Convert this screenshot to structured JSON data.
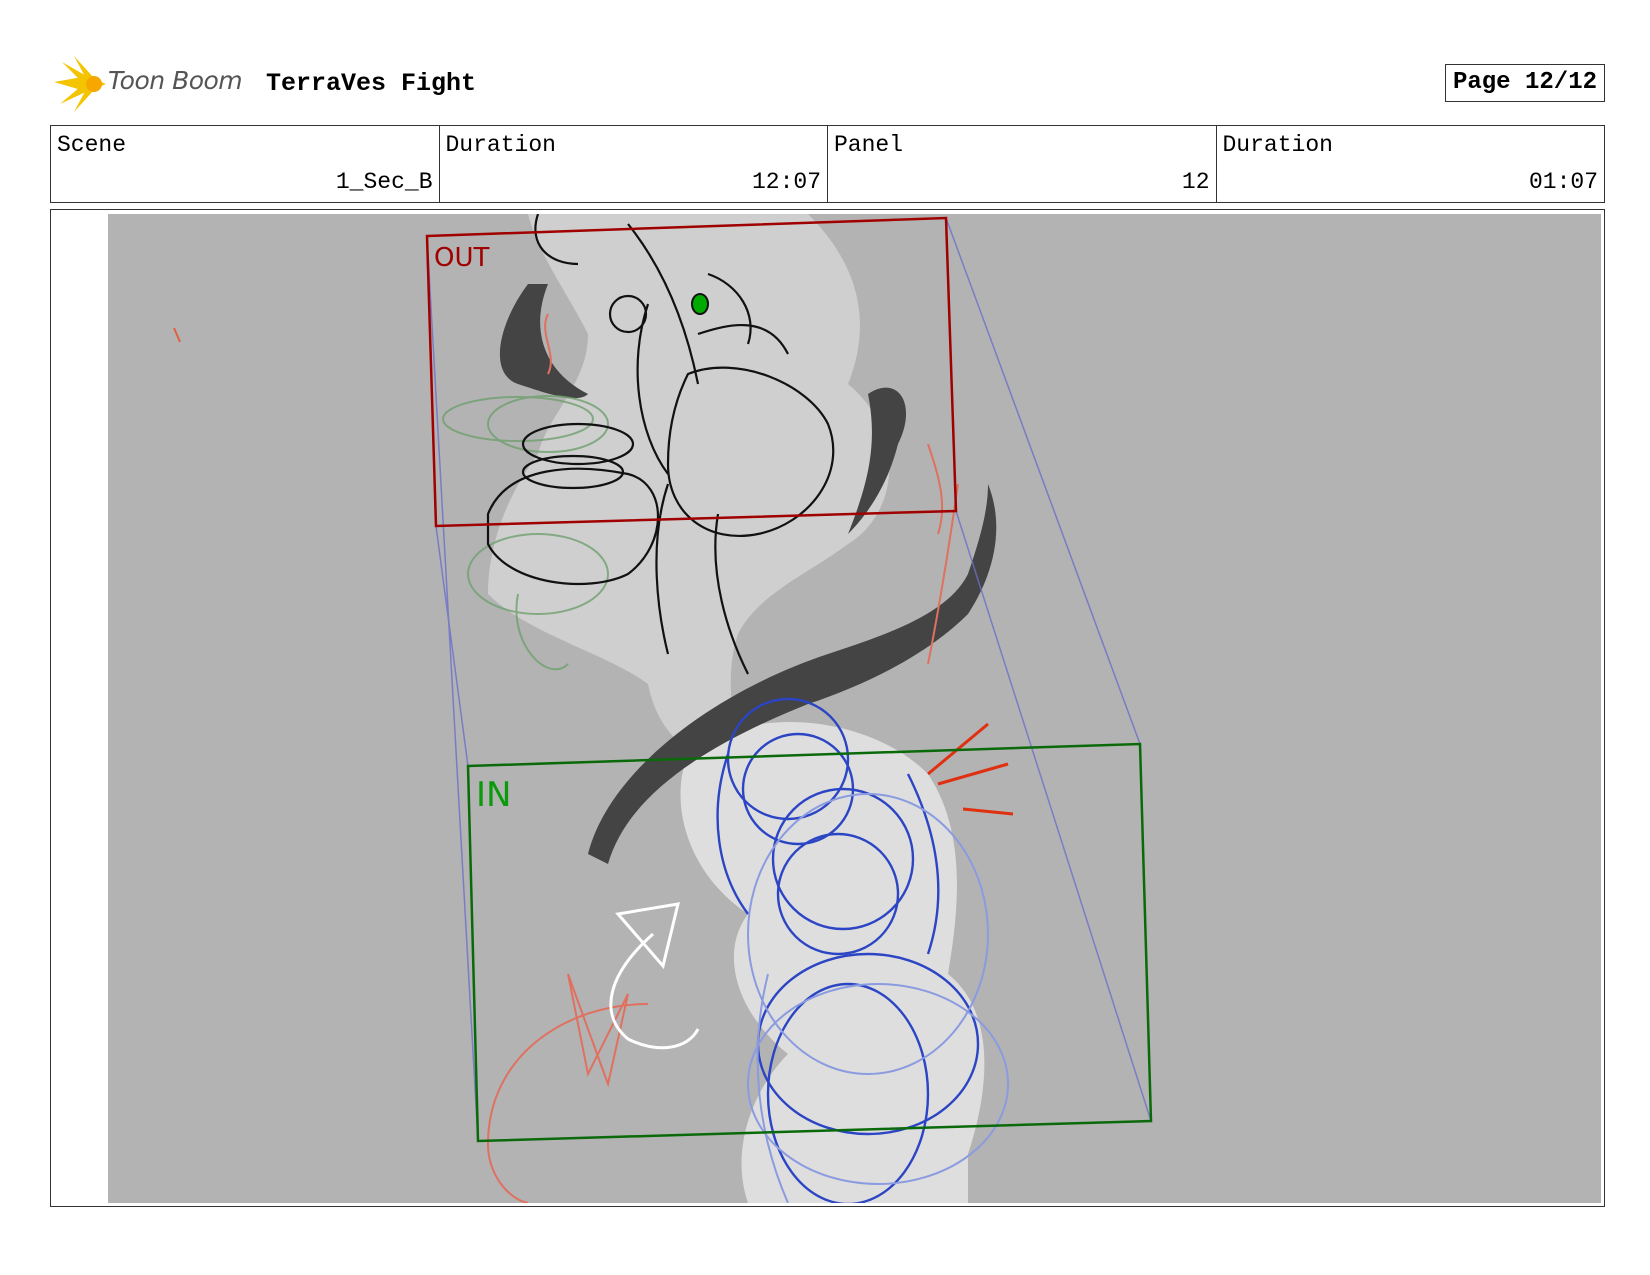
{
  "header": {
    "logo_text": "Toon Boom",
    "project_title": "TerraVes Fight",
    "page": "Page 12/12"
  },
  "info": {
    "scene_label": "Scene",
    "scene_value": "1_Sec_B",
    "scene_duration_label": "Duration",
    "scene_duration_value": "12:07",
    "panel_label": "Panel",
    "panel_value": "12",
    "panel_duration_label": "Duration",
    "panel_duration_value": "01:07"
  },
  "panel": {
    "out_label": "OUT",
    "in_label": "IN"
  },
  "colors": {
    "background_gray": "#b3b3b3",
    "out_frame": "#a00000",
    "in_frame": "#0a7a0a",
    "camera_guides": "#6b6fc8",
    "blue_sketch": "#2b45c4",
    "red_sketch": "#e03010"
  }
}
